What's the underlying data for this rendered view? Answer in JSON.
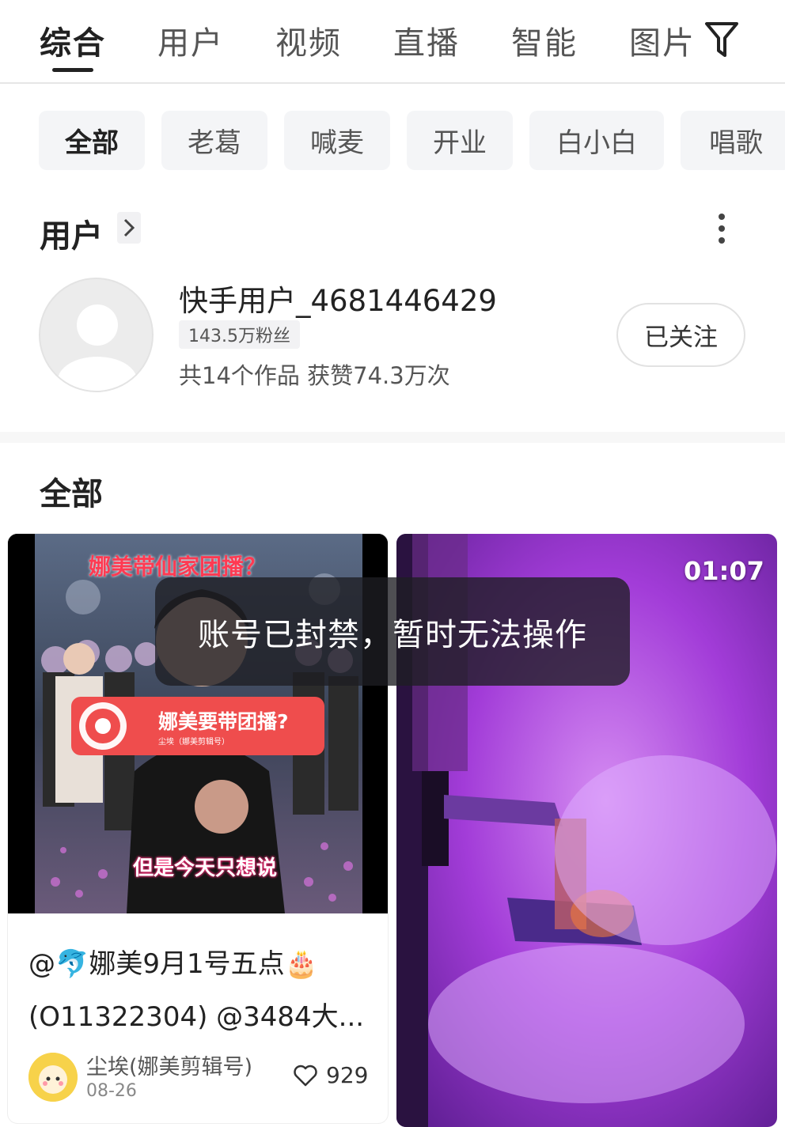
{
  "tabs": [
    {
      "label": "综合",
      "active": true
    },
    {
      "label": "用户",
      "active": false
    },
    {
      "label": "视频",
      "active": false
    },
    {
      "label": "直播",
      "active": false
    },
    {
      "label": "智能",
      "active": false
    },
    {
      "label": "图片",
      "active": false
    }
  ],
  "filter_icon": "filter-funnel-icon",
  "chips": [
    {
      "label": "全部",
      "active": true
    },
    {
      "label": "老葛",
      "active": false
    },
    {
      "label": "喊麦",
      "active": false
    },
    {
      "label": "开业",
      "active": false
    },
    {
      "label": "白小白",
      "active": false
    },
    {
      "label": "唱歌",
      "active": false
    }
  ],
  "users_section": {
    "title": "用户",
    "user": {
      "name": "快手用户_4681446429",
      "fans": "143.5万粉丝",
      "stats": "共14个作品 获赞74.3万次",
      "follow_label": "已关注"
    }
  },
  "all_section": {
    "title": "全部"
  },
  "videos": [
    {
      "overlay_top": "娜美带仙家团播？",
      "sticker_title": "娜美要带团播?",
      "sticker_sub": "尘埃（娜美剪辑号）",
      "subtitle": "但是今天只想说",
      "caption_line1": "@🐬娜美9月1号五点🎂",
      "caption_line2": "(O11322304) @3484大...",
      "author": "尘埃(娜美剪辑号)",
      "date": "08-26",
      "likes": "929"
    },
    {
      "duration": "01:07"
    }
  ],
  "toast": "账号已封禁，暂时无法操作",
  "colors": {
    "chip_bg": "#f4f5f7",
    "toast_bg": "#1e1e22",
    "sticker_red": "#ef4d4d",
    "purple_haze": "#a23cd8"
  }
}
